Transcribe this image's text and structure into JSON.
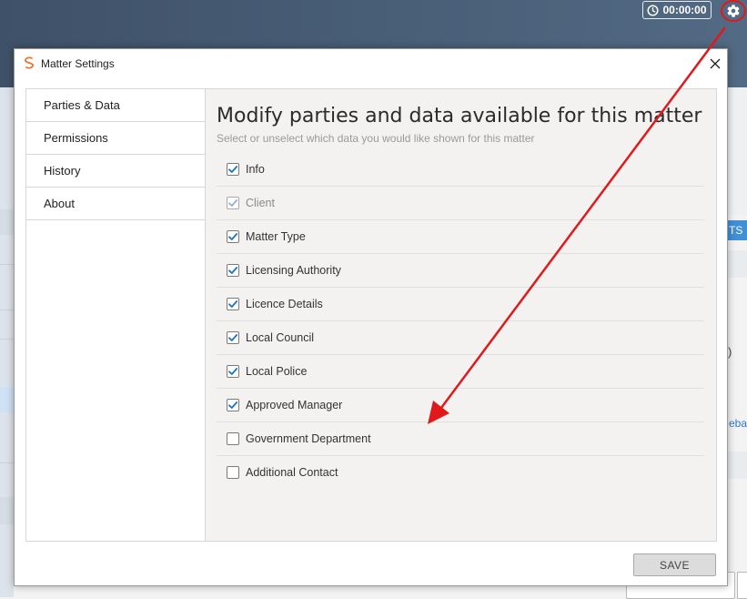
{
  "header": {
    "timer": "00:00:00"
  },
  "dialog": {
    "title": "Matter Settings",
    "close_icon": "close-icon"
  },
  "sidebar": {
    "items": [
      {
        "label": "Parties & Data",
        "active": true
      },
      {
        "label": "Permissions",
        "active": false
      },
      {
        "label": "History",
        "active": false
      },
      {
        "label": "About",
        "active": false
      }
    ]
  },
  "content": {
    "title": "Modify parties and data available for this matter",
    "subtitle": "Select or unselect which data you would like shown for this matter",
    "options": [
      {
        "label": "Info",
        "checked": true,
        "disabled": false
      },
      {
        "label": "Client",
        "checked": true,
        "disabled": true
      },
      {
        "label": "Matter Type",
        "checked": true,
        "disabled": false
      },
      {
        "label": "Licensing Authority",
        "checked": true,
        "disabled": false
      },
      {
        "label": "Licence Details",
        "checked": true,
        "disabled": false
      },
      {
        "label": "Local Council",
        "checked": true,
        "disabled": false
      },
      {
        "label": "Local Police",
        "checked": true,
        "disabled": false
      },
      {
        "label": "Approved Manager",
        "checked": true,
        "disabled": false
      },
      {
        "label": "Government Department",
        "checked": false,
        "disabled": false
      },
      {
        "label": "Additional Contact",
        "checked": false,
        "disabled": false
      }
    ]
  },
  "footer": {
    "save_label": "SAVE"
  },
  "background": {
    "right_tab": "TS",
    "right_link": "eball",
    "right_paren": ")"
  },
  "colors": {
    "header_bg": "#46596f",
    "checkbox_check": "#1a73c8",
    "annotation_red": "#e0191b",
    "tab_blue": "#3f8fd9"
  }
}
